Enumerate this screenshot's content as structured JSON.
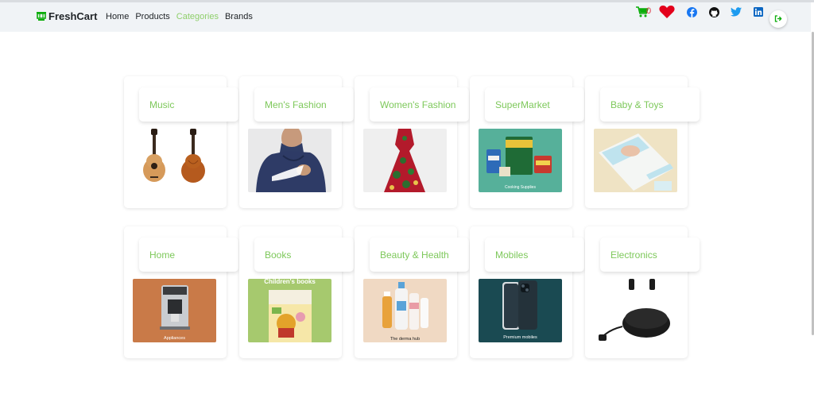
{
  "nav": {
    "brand": "FreshCart",
    "links": [
      {
        "label": "Home",
        "active": false
      },
      {
        "label": "Products",
        "active": false
      },
      {
        "label": "Categories",
        "active": true
      },
      {
        "label": "Brands",
        "active": false
      }
    ],
    "cart_count": "0",
    "icons": [
      "cart-icon",
      "heart-icon",
      "facebook-icon",
      "github-icon",
      "twitter-icon",
      "linkedin-icon",
      "logout-icon"
    ]
  },
  "colors": {
    "accent": "#7dc85a",
    "brand_green": "#0aad0a",
    "heart": "#e3001b",
    "cart_badge": "#dc3545"
  },
  "categories": [
    {
      "name": "Music",
      "image_caption": ""
    },
    {
      "name": "Men's Fashion",
      "image_caption": ""
    },
    {
      "name": "Women's Fashion",
      "image_caption": ""
    },
    {
      "name": "SuperMarket",
      "image_caption": "Cooking Supplies"
    },
    {
      "name": "Baby & Toys",
      "image_caption": ""
    },
    {
      "name": "Home",
      "image_caption": "Appliances"
    },
    {
      "name": "Books",
      "image_caption": "Children's books"
    },
    {
      "name": "Beauty & Health",
      "image_caption": "The derma hub"
    },
    {
      "name": "Mobiles",
      "image_caption": "Premium mobiles"
    },
    {
      "name": "Electronics",
      "image_caption": ""
    }
  ]
}
